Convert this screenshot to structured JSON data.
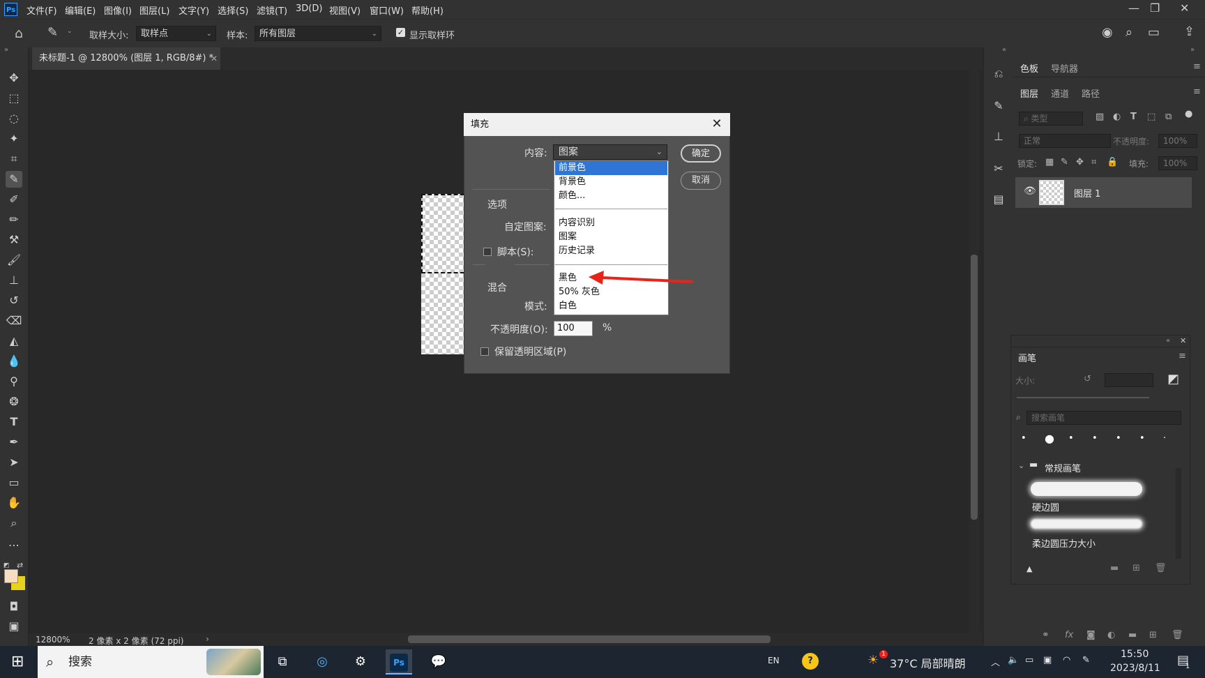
{
  "app": {
    "logo": "Ps",
    "document_tab": "未标题-1 @ 12800% (图层 1, RGB/8#) *"
  },
  "menu": {
    "items": [
      "文件(F)",
      "编辑(E)",
      "图像(I)",
      "图层(L)",
      "文字(Y)",
      "选择(S)",
      "滤镜(T)",
      "3D(D)",
      "视图(V)",
      "窗口(W)",
      "帮助(H)"
    ]
  },
  "options_bar": {
    "sample_size_label": "取样大小:",
    "sample_size_value": "取样点",
    "sample_label": "样本:",
    "sample_value": "所有图层",
    "show_ring_label": "显示取样环",
    "show_ring_checked": true
  },
  "status_bar": {
    "zoom": "12800%",
    "doc_info": "2 像素 x 2 像素 (72 ppi)"
  },
  "panels": {
    "top_tabs": [
      "色板",
      "导航器"
    ],
    "layer_tabs": [
      "图层",
      "通道",
      "路径"
    ],
    "layer_search_placeholder": "类型",
    "blend_mode": "正常",
    "opacity_label": "不透明度:",
    "opacity_value": "100%",
    "lock_label": "锁定:",
    "fill_label": "填充:",
    "fill_value": "100%",
    "layers": [
      {
        "name": "图层 1",
        "visible": true
      }
    ]
  },
  "brush_panel": {
    "title": "画笔",
    "size_label": "大小:",
    "search_placeholder": "搜索画笔",
    "group_name": "常规画笔",
    "brushes": [
      "硬边圆",
      "柔边圆压力大小"
    ]
  },
  "dialog": {
    "title": "填充",
    "content_label": "内容:",
    "content_value": "图案",
    "ok_label": "确定",
    "cancel_label": "取消",
    "options_group": "选项",
    "custom_pattern_label": "自定图案:",
    "script_label": "脚本(S):",
    "blend_group": "混合",
    "mode_label": "模式:",
    "opacity_label": "不透明度(O):",
    "opacity_value": "100",
    "percent": "%",
    "preserve_label": "保留透明区域(P)",
    "dropdown_items": [
      "前景色",
      "背景色",
      "颜色...",
      "内容识别",
      "图案",
      "历史记录",
      "黑色",
      "50% 灰色",
      "白色"
    ],
    "dropdown_selected": "前景色",
    "annotation_arrow_color": "#e8231a"
  },
  "taskbar": {
    "search_placeholder": "搜索",
    "ime": "EN",
    "weather": "37°C 局部晴朗",
    "time": "15:50",
    "date": "2023/8/11",
    "notification_count": "1",
    "weather_badge": "1"
  },
  "colors": {
    "accent": "#2f75d6",
    "foreground_swatch": "#f6dcc0",
    "background_swatch": "#e8d21e"
  }
}
